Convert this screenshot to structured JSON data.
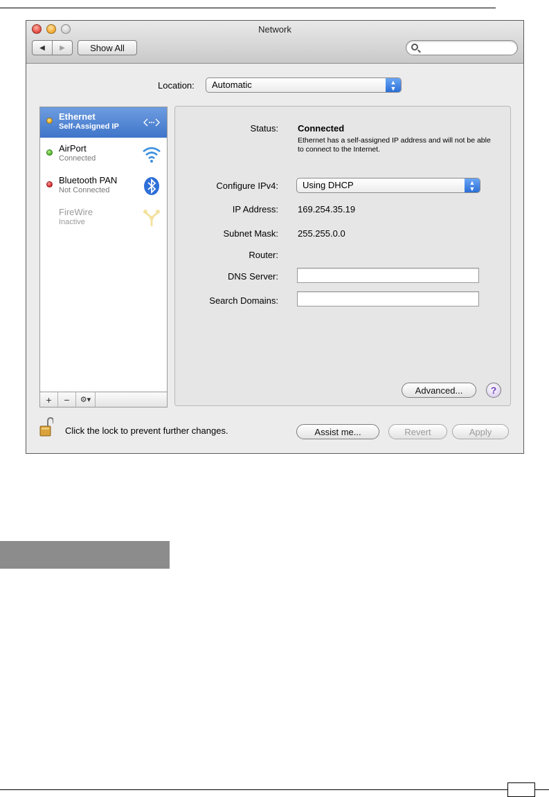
{
  "window": {
    "title": "Network"
  },
  "toolbar": {
    "back_glyph": "◀",
    "forward_glyph": "▶",
    "show_all_label": "Show All",
    "search_placeholder": ""
  },
  "location": {
    "label": "Location:",
    "value": "Automatic"
  },
  "services": [
    {
      "name": "Ethernet",
      "status": "Self-Assigned IP",
      "dot": "yellow",
      "icon": "ethernet-icon",
      "selected": true
    },
    {
      "name": "AirPort",
      "status": "Connected",
      "dot": "green",
      "icon": "wifi-icon",
      "selected": false
    },
    {
      "name": "Bluetooth PAN",
      "status": "Not Connected",
      "dot": "red",
      "icon": "bluetooth-icon",
      "selected": false
    },
    {
      "name": "FireWire",
      "status": "Inactive",
      "dot": "none",
      "icon": "firewire-icon",
      "selected": false
    }
  ],
  "list_tools": {
    "add": "+",
    "remove": "−",
    "gear": "⚙▾"
  },
  "detail": {
    "status_label": "Status:",
    "status_value": "Connected",
    "status_note": "Ethernet has a self-assigned IP address and will not be able to connect to the Internet.",
    "configure_label": "Configure IPv4:",
    "configure_value": "Using DHCP",
    "ip_label": "IP Address:",
    "ip_value": "169.254.35.19",
    "subnet_label": "Subnet Mask:",
    "subnet_value": "255.255.0.0",
    "router_label": "Router:",
    "router_value": "",
    "dns_label": "DNS Server:",
    "dns_value": "",
    "search_domains_label": "Search Domains:",
    "search_domains_value": "",
    "advanced_label": "Advanced...",
    "help_label": "?"
  },
  "footer": {
    "lock_text": "Click the lock to prevent further changes.",
    "assist_label": "Assist me...",
    "revert_label": "Revert",
    "apply_label": "Apply"
  },
  "colors": {
    "selection": "#3e74c9",
    "status_yellow": "#e8a413",
    "status_green": "#3eae1f",
    "status_red": "#d01818",
    "help_purple": "#6b3fb8"
  }
}
